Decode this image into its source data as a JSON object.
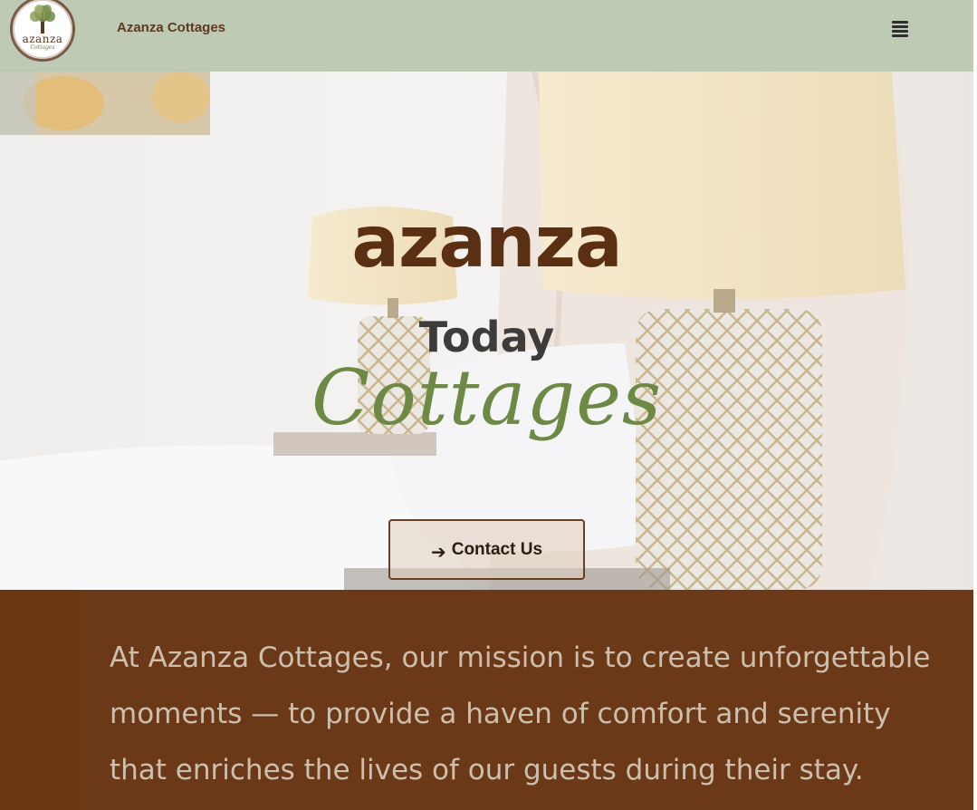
{
  "header": {
    "logo": {
      "text": "azanza",
      "subtext": "Cottages",
      "icon": "tree-icon"
    },
    "site_title": "Azanza Cottages",
    "menu_icon": "hamburger-menu-icon"
  },
  "hero": {
    "brand": "azanza",
    "line1": "Today",
    "line2": "Cottages",
    "cta": {
      "icon": "arrow-right-icon",
      "label": "Contact Us"
    }
  },
  "mission": {
    "text": "At Azanza Cottages, our mission is to create unforgettable moments — to provide a haven of comfort and serenity that enriches the lives of our guests during their stay."
  },
  "colors": {
    "header_bg": "#bfcab5",
    "brand_brown": "#5a2f12",
    "accent_green": "#6d8a45",
    "mission_bg": "#6a3712",
    "mission_text": "#cdbfae"
  }
}
